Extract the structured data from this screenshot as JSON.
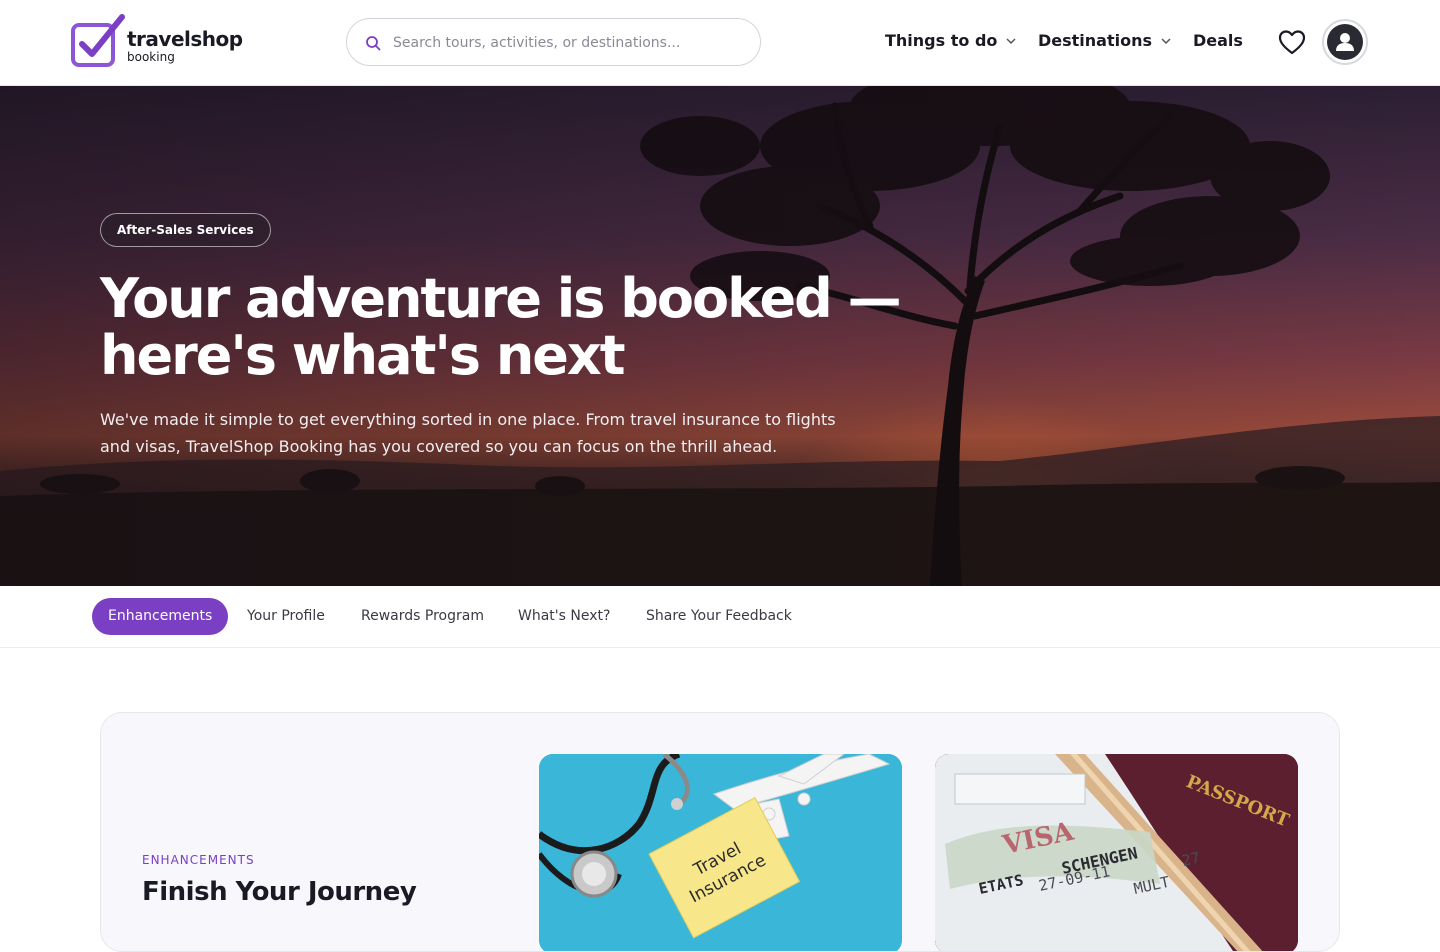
{
  "brand": {
    "name": "travelshop",
    "sub": "booking",
    "accent": "#7b3fc4"
  },
  "search": {
    "placeholder": "Search tours, activities, or destinations..."
  },
  "nav": {
    "things_to_do": "Things to do",
    "destinations": "Destinations",
    "deals": "Deals"
  },
  "icons": {
    "search": "search-icon",
    "wishlist": "heart-icon",
    "account": "user-avatar-icon",
    "dropdown": "chevron-down-icon"
  },
  "hero": {
    "badge": "After-Sales Services",
    "title": "Your adventure is booked — here's what's next",
    "description": "We've made it simple to get everything sorted in one place. From travel insurance to flights and visas, TravelShop Booking has you covered so you can focus on the thrill ahead."
  },
  "tabs": [
    {
      "label": "Enhancements",
      "active": true
    },
    {
      "label": "Your Profile",
      "active": false
    },
    {
      "label": "Rewards Program",
      "active": false
    },
    {
      "label": "What's Next?",
      "active": false
    },
    {
      "label": "Share Your Feedback",
      "active": false
    }
  ],
  "section": {
    "eyebrow": "ENHANCEMENTS",
    "title": "Finish Your Journey"
  },
  "tiles": {
    "insurance_text": [
      "Travel",
      "Insurance"
    ],
    "visa_stamp": "VISA",
    "visa_schengen": "SCHENGEN",
    "visa_etats": "ETATS",
    "visa_date": "27-09-11",
    "visa_multi": "MULT",
    "visa_num": "27",
    "passport": "PASSPORT"
  }
}
